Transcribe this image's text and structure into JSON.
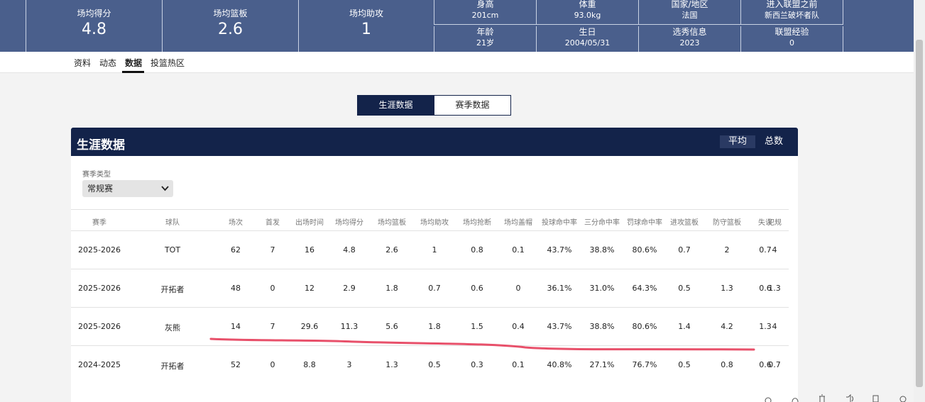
{
  "player": {
    "stats": [
      {
        "label": "场均得分",
        "value": "4.8"
      },
      {
        "label": "场均篮板",
        "value": "2.6"
      },
      {
        "label": "场均助攻",
        "value": "1"
      }
    ],
    "info": [
      {
        "label": "身高",
        "value": "201cm"
      },
      {
        "label": "体重",
        "value": "93.0kg"
      },
      {
        "label": "国家/地区",
        "value": "法国"
      },
      {
        "label": "进入联盟之前",
        "value": "新西兰破坏者队"
      },
      {
        "label": "年龄",
        "value": "21岁"
      },
      {
        "label": "生日",
        "value": "2004/05/31"
      },
      {
        "label": "选秀信息",
        "value": "2023"
      },
      {
        "label": "联盟经验",
        "value": "0"
      }
    ]
  },
  "subnav": [
    "资料",
    "动态",
    "数据",
    "投篮热区"
  ],
  "toggle": {
    "career": "生涯数据",
    "season": "赛季数据"
  },
  "panel": {
    "title": "生涯数据",
    "mode_avg": "平均",
    "mode_total": "总数",
    "season_type_label": "赛季类型",
    "season_type_value": "常规赛"
  },
  "table": {
    "headers": [
      "赛季",
      "球队",
      "场次",
      "首发",
      "出场时间",
      "场均得分",
      "场均篮板",
      "场均助攻",
      "场均抢断",
      "场均盖帽",
      "投球命中率",
      "三分命中率",
      "罚球命中率",
      "进攻篮板",
      "防守篮板",
      "失误",
      "犯规"
    ],
    "rows": [
      [
        "2025-2026",
        "TOT",
        "62",
        "7",
        "16",
        "4.8",
        "2.6",
        "1",
        "0.8",
        "0.1",
        "43.7%",
        "38.8%",
        "80.6%",
        "0.7",
        "2",
        "0.7",
        "4"
      ],
      [
        "2025-2026",
        "开拓者",
        "48",
        "0",
        "12",
        "2.9",
        "1.8",
        "0.7",
        "0.6",
        "0",
        "36.1%",
        "31.0%",
        "64.3%",
        "0.5",
        "1.3",
        "0.6",
        "1.3"
      ],
      [
        "2025-2026",
        "灰熊",
        "14",
        "7",
        "29.6",
        "11.3",
        "5.6",
        "1.8",
        "1.5",
        "0.4",
        "43.7%",
        "38.8%",
        "80.6%",
        "1.4",
        "4.2",
        "1.3",
        "4"
      ],
      [
        "2024-2025",
        "开拓者",
        "52",
        "0",
        "8.8",
        "3",
        "1.3",
        "0.5",
        "0.3",
        "0.1",
        "40.8%",
        "27.1%",
        "76.7%",
        "0.5",
        "0.8",
        "0.6",
        "0.7"
      ]
    ]
  },
  "colors": {
    "banner": "#4a5f8c",
    "navy": "#13234a",
    "annotation": "#e8506a"
  },
  "icons": [
    "share-icon",
    "favorite-icon",
    "delete-icon",
    "read-aloud-icon",
    "copy-icon",
    "feedback-icon"
  ]
}
